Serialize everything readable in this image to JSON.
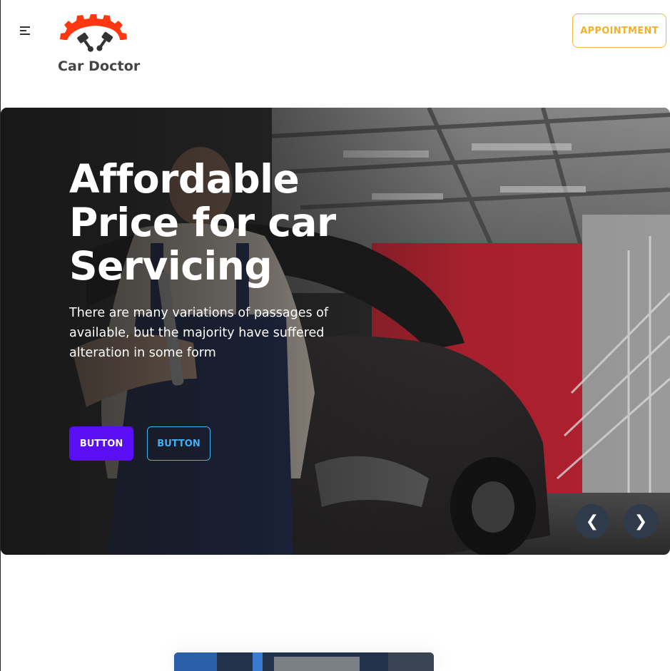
{
  "header": {
    "brand": "Car Doctor",
    "appointment_label": "APPOINTMENT",
    "menu_icon": "hamburger-menu-icon",
    "logo_icon": "gear-pistons-logo"
  },
  "hero": {
    "title": "Affordable Price for car Servicing",
    "description": "There are many variations of passages of available, but the majority have suffered alteration in some form",
    "primary_button_label": "BUTTON",
    "secondary_button_label": "BUTTON",
    "prev_label": "❮",
    "next_label": "❯"
  },
  "colors": {
    "brand_orange": "#ff3811",
    "appointment_accent": "#f3b12a",
    "primary_button": "#5a0ef6",
    "outline_button": "#3fb0f0",
    "nav_button": "#2f3a4b"
  }
}
